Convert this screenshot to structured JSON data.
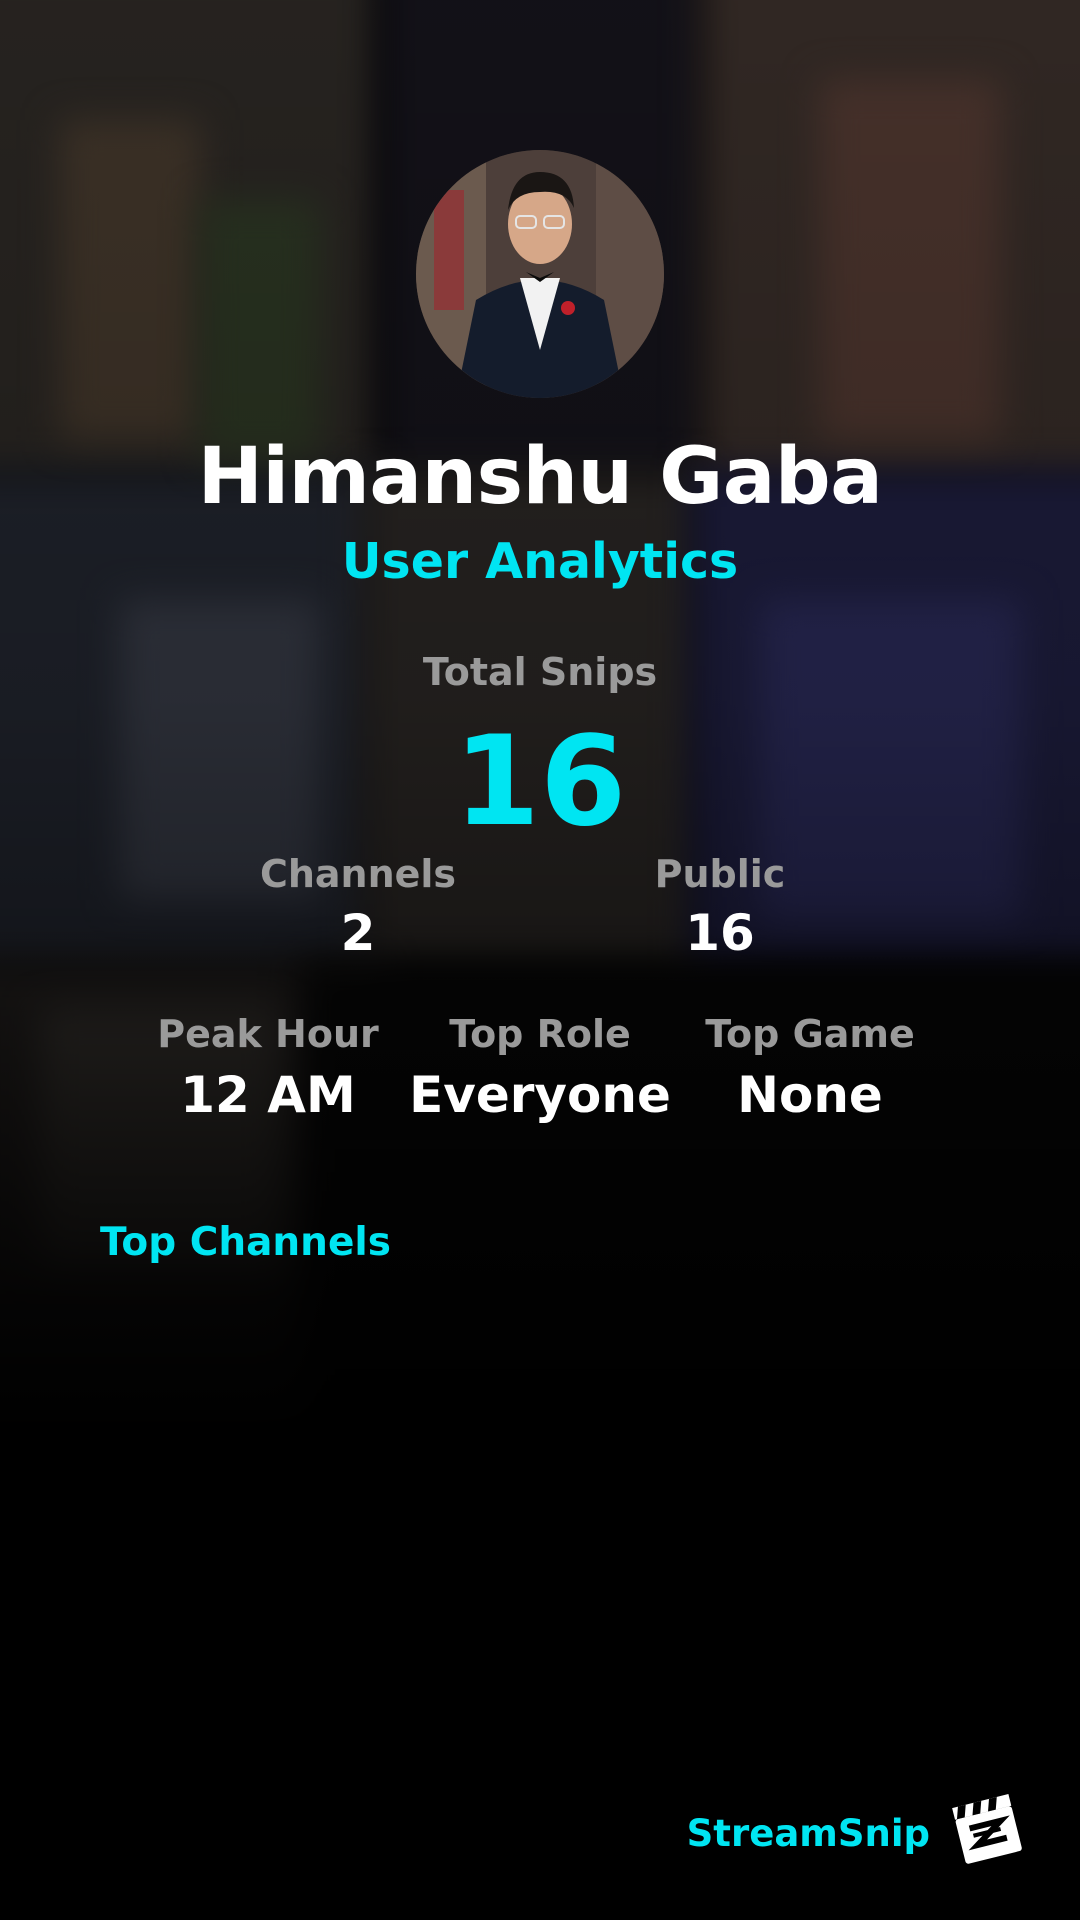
{
  "profile": {
    "name": "Himanshu Gaba",
    "subtitle": "User Analytics"
  },
  "totals": {
    "label": "Total Snips",
    "value": "16"
  },
  "stats_row1": [
    {
      "label": "Channels",
      "value": "2"
    },
    {
      "label": "Public",
      "value": "16"
    }
  ],
  "stats_row2": [
    {
      "label": "Peak Hour",
      "value": "12 AM"
    },
    {
      "label": "Top Role",
      "value": "Everyone"
    },
    {
      "label": "Top Game",
      "value": "None"
    }
  ],
  "sections": {
    "top_channels": "Top Channels"
  },
  "footer": {
    "brand": "StreamSnip",
    "logo_icon": "clapperboard-icon"
  },
  "colors": {
    "accent": "#00e5f2",
    "text": "#ffffff",
    "muted": "#9a9a9a",
    "background": "#000000"
  }
}
